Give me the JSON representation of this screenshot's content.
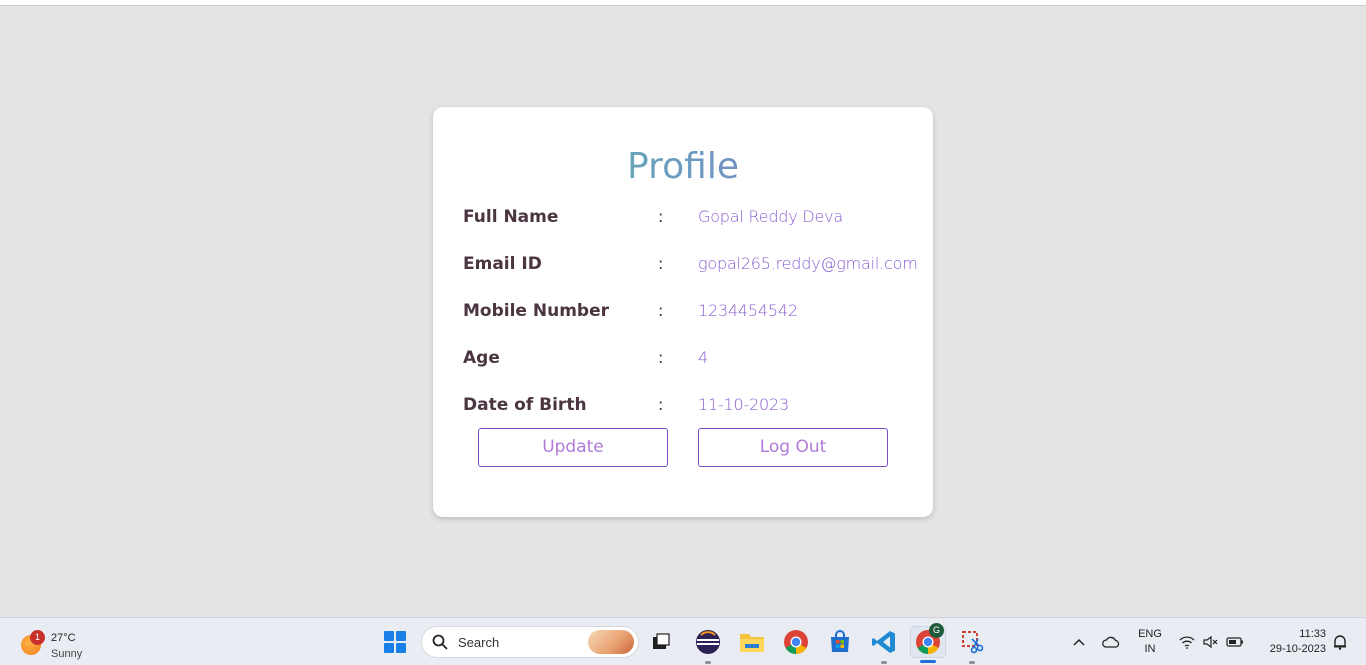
{
  "profile": {
    "title": "Profile",
    "fields": [
      {
        "label": "Full Name",
        "colon": ":",
        "value": "Gopal Reddy Deva"
      },
      {
        "label": "Email ID",
        "colon": ":",
        "value": "gopal265.reddy@gmail.com"
      },
      {
        "label": "Mobile Number",
        "colon": ":",
        "value": "1234454542"
      },
      {
        "label": "Age",
        "colon": ":",
        "value": "4"
      },
      {
        "label": "Date of Birth",
        "colon": ":",
        "value": "11-10-2023"
      }
    ],
    "update_label": "Update",
    "logout_label": "Log Out",
    "colors": {
      "label": "#4a3540",
      "value": "#8a5fd0",
      "button_border": "#7a4fc6"
    }
  },
  "taskbar": {
    "weather": {
      "badge": "1",
      "temp": "27°C",
      "condition": "Sunny"
    },
    "search_label": "Search",
    "apps": [
      {
        "icon": "windows-start-icon"
      },
      {
        "icon": "search-icon"
      },
      {
        "icon": "task-view-icon"
      },
      {
        "icon": "eclipse-icon"
      },
      {
        "icon": "file-explorer-icon"
      },
      {
        "icon": "chrome-icon"
      },
      {
        "icon": "microsoft-store-icon"
      },
      {
        "icon": "vscode-icon"
      },
      {
        "icon": "chrome-profile-icon",
        "badge": "G"
      },
      {
        "icon": "snipping-tool-icon"
      }
    ],
    "tray": {
      "lang_top": "ENG",
      "lang_bottom": "IN",
      "time": "11:33",
      "date": "29-10-2023"
    }
  }
}
